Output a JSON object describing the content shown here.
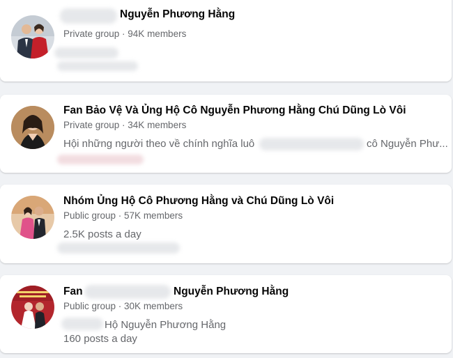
{
  "groups": [
    {
      "title": "Nguyễn Phương Hằng",
      "meta": "Private group · 94K members",
      "description": "",
      "icon": "group-avatar-couple-red-dress"
    },
    {
      "title": "Fan Bảo Vệ Và Ủng Hộ Cô Nguyễn Phương Hằng Chú Dũng Lò Vôi",
      "meta": "Private group · 34K members",
      "description_part1": "Hội những người theo về chính nghĩa luô",
      "description_part2": "cô Nguyễn Phư...",
      "icon": "group-avatar-woman-portrait"
    },
    {
      "title": "Nhóm Ủng Hộ Cô Phương Hằng và Chú Dũng Lò Vôi",
      "meta": "Public group · 57K members",
      "description": "2.5K posts a day",
      "icon": "group-avatar-couple-pink-dress"
    },
    {
      "title_prefix": "Fan",
      "title_suffix": "Nguyễn Phương Hằng",
      "meta": "Public group · 30K members",
      "description_line1": "Hộ Nguyễn Phương Hằng",
      "description_line2": "160 posts a day",
      "icon": "group-avatar-couple-red-banner"
    }
  ]
}
